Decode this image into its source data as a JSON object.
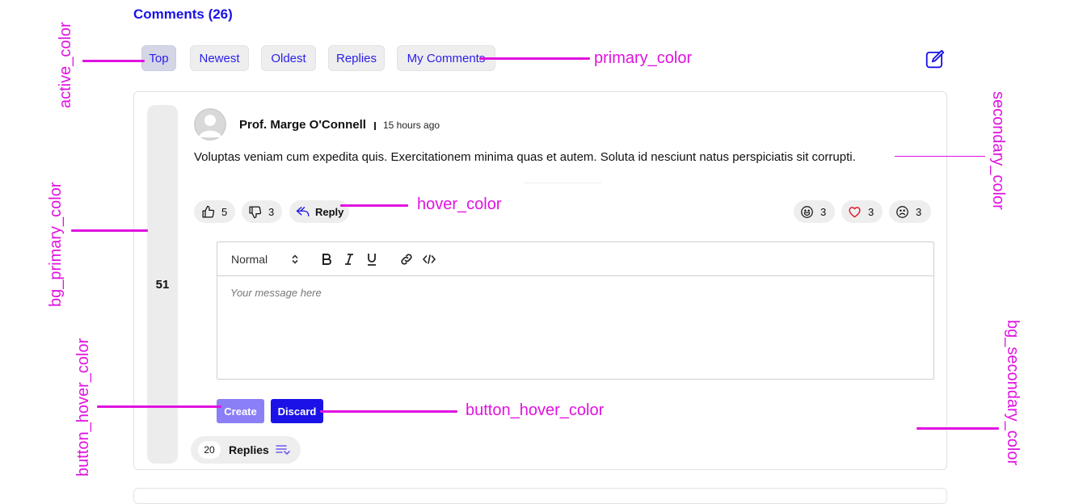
{
  "header": {
    "title": "Comments (26)",
    "tabs": [
      {
        "label": "Top",
        "active": true
      },
      {
        "label": "Newest",
        "active": false
      },
      {
        "label": "Oldest",
        "active": false
      },
      {
        "label": "Replies",
        "active": false
      },
      {
        "label": "My Comments",
        "active": false
      }
    ],
    "edit_icon": "edit-icon"
  },
  "comment": {
    "score": "51",
    "author": "Prof. Marge O'Connell",
    "time": "15 hours ago",
    "text": "Voluptas veniam cum expedita quis. Exercitationem minima quas et autem. Soluta id nesciunt natus perspiciatis sit corrupti.",
    "likes": "5",
    "dislikes": "3",
    "reply_label": "Reply",
    "reactions": [
      {
        "icon": "laugh-icon",
        "count": "3"
      },
      {
        "icon": "heart-icon",
        "count": "3"
      },
      {
        "icon": "sad-icon",
        "count": "3"
      }
    ]
  },
  "editor": {
    "format": "Normal",
    "placeholder": "Your message here",
    "create_label": "Create",
    "discard_label": "Discard"
  },
  "replies": {
    "count": "20",
    "label": "Replies"
  },
  "annotations": {
    "active_color": "active_color",
    "primary_color": "primary_color",
    "secondary_color": "secondary_color",
    "hover_color": "hover_color",
    "bg_primary_color": "bg_primary_color",
    "button_hover_color_left": "button_hover_color",
    "button_hover_color_right": "button_hover_color",
    "bg_secondary_color": "bg_secondary_color"
  },
  "colors": {
    "primary": "#1a12e6",
    "button_light": "#8a7ff7",
    "annotation": "#e012e0",
    "heart": "#e0142a"
  }
}
